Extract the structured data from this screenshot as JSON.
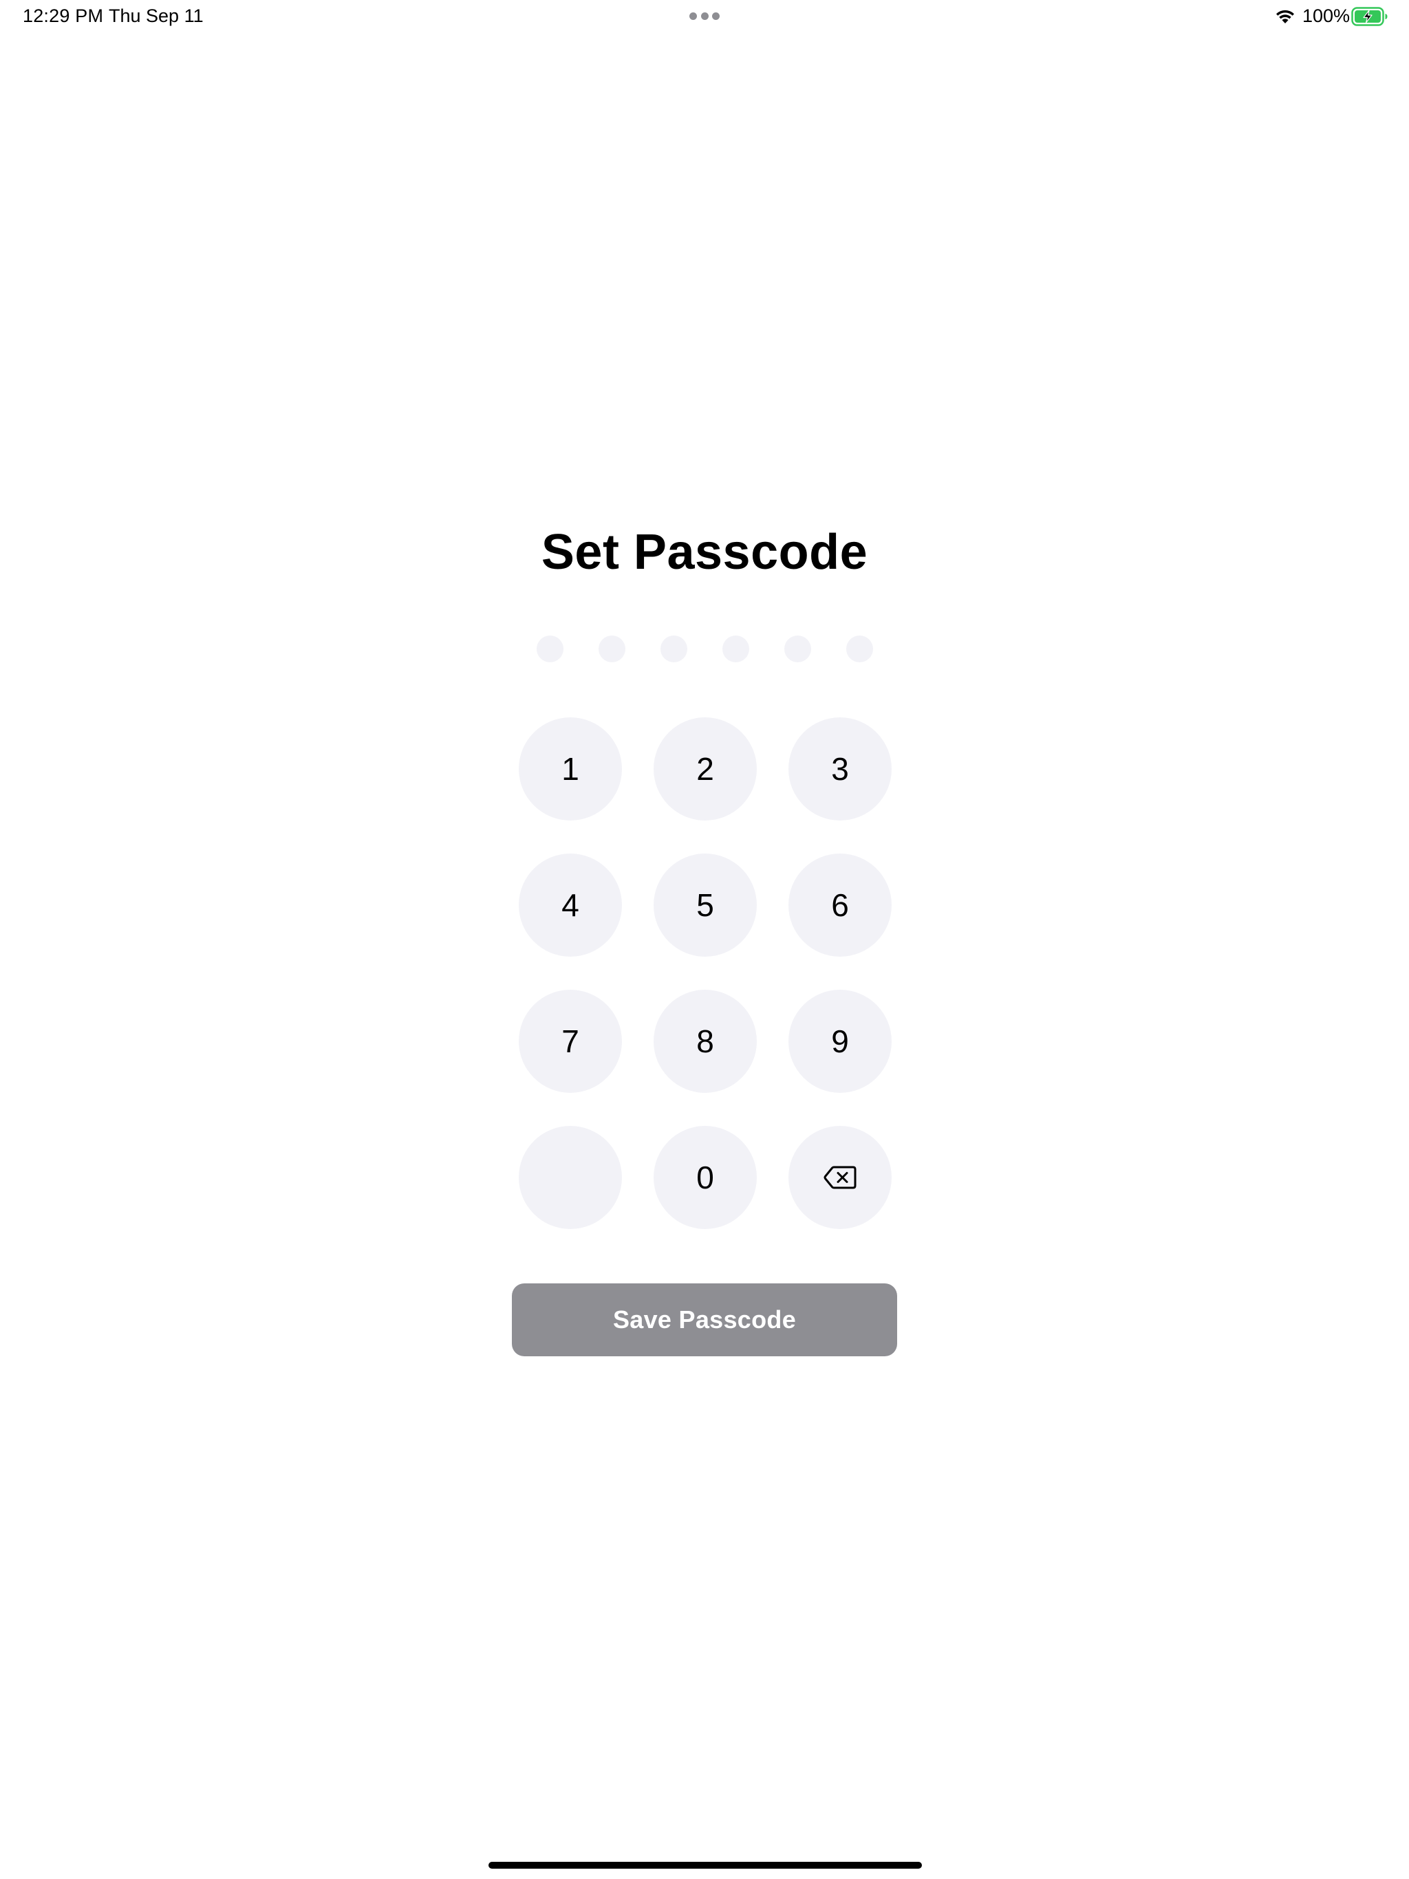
{
  "status_bar": {
    "time": "12:29 PM",
    "date": "Thu Sep 11",
    "battery_percent": "100%",
    "battery_level": 1.0,
    "charging": true,
    "wifi_icon": "wifi-icon",
    "battery_icon": "battery-charging-icon",
    "multitask_icon": "ellipsis-icon"
  },
  "passcode": {
    "title": "Set Passcode",
    "digits_total": 6,
    "digits_entered": 0
  },
  "keypad": {
    "keys": [
      "1",
      "2",
      "3",
      "4",
      "5",
      "6",
      "7",
      "8",
      "9",
      "",
      "0"
    ],
    "delete_icon": "delete-backward-icon"
  },
  "save_button": {
    "label": "Save Passcode",
    "enabled": false
  },
  "colors": {
    "background": "#ffffff",
    "key_fill": "#f2f2f7",
    "dot_empty": "#f2f2f7",
    "button_disabled": "#8e8e93",
    "battery_green": "#34c759",
    "text": "#000000"
  }
}
